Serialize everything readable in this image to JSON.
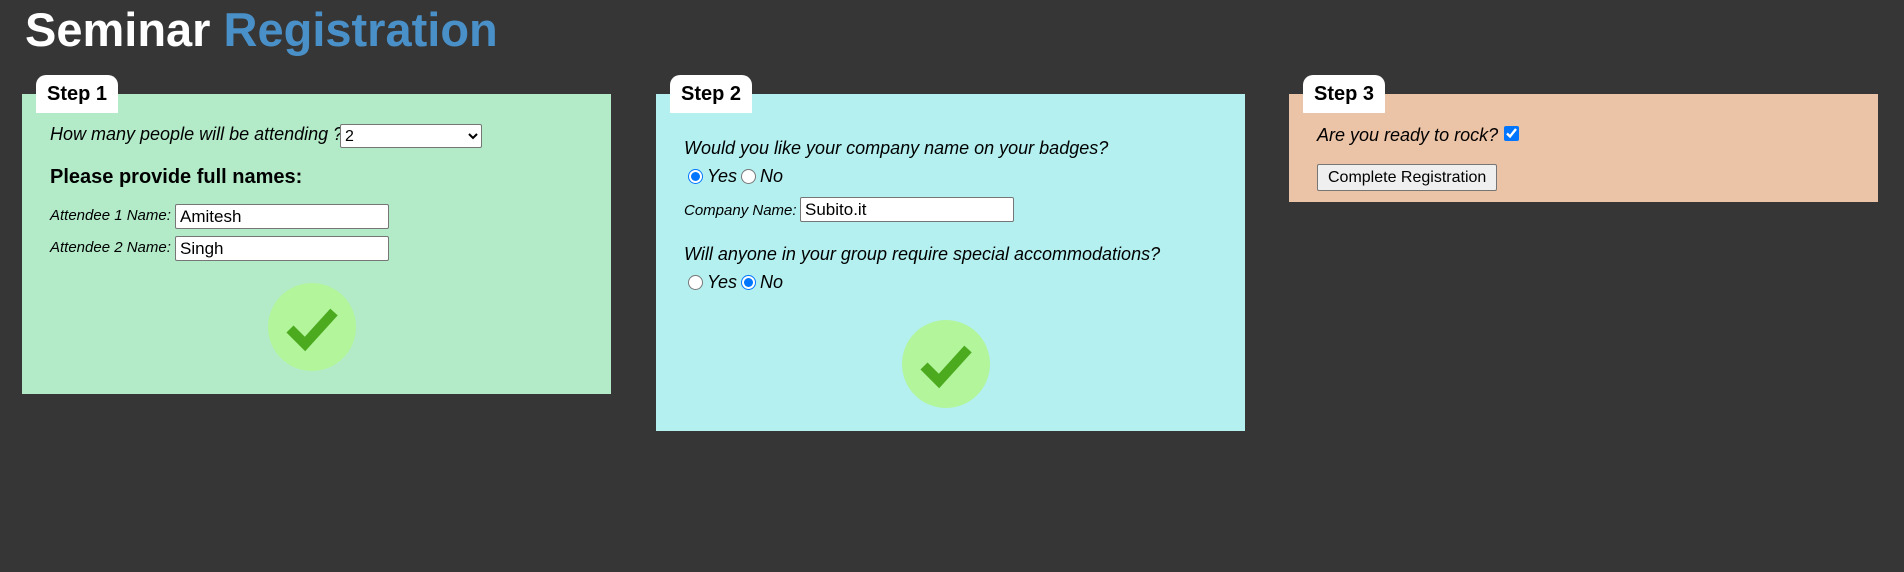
{
  "title": {
    "main": "Seminar",
    "accent": "Registration"
  },
  "colors": {
    "background": "#363636",
    "title_accent": "#4a90c8",
    "step1_bg": "#b3ebc9",
    "step2_bg": "#b4f0f0",
    "step3_bg": "#ebc3a6",
    "check_circle": "#b2f59b",
    "check_mark": "#4caa1f"
  },
  "step1": {
    "tab": "Step 1",
    "question": "How many people will be attending ?",
    "attendee_count": "2",
    "names_heading": "Please provide full names:",
    "attendees": [
      {
        "label": "Attendee 1 Name:",
        "value": "Amitesh"
      },
      {
        "label": "Attendee 2 Name:",
        "value": "Singh"
      }
    ],
    "complete_icon": "check-circle-icon"
  },
  "step2": {
    "tab": "Step 2",
    "badge_question": "Would you like your company name on your badges?",
    "badge_yes": "Yes",
    "badge_no": "No",
    "badge_selected": "Yes",
    "company_label": "Company Name:",
    "company_value": "Subito.it",
    "accommodation_question": "Will anyone in your group require special accommodations?",
    "accom_yes": "Yes",
    "accom_no": "No",
    "accom_selected": "No",
    "complete_icon": "check-circle-icon"
  },
  "step3": {
    "tab": "Step 3",
    "ready_question": "Are you ready to rock?",
    "ready_checked": true,
    "submit_label": "Complete Registration"
  }
}
